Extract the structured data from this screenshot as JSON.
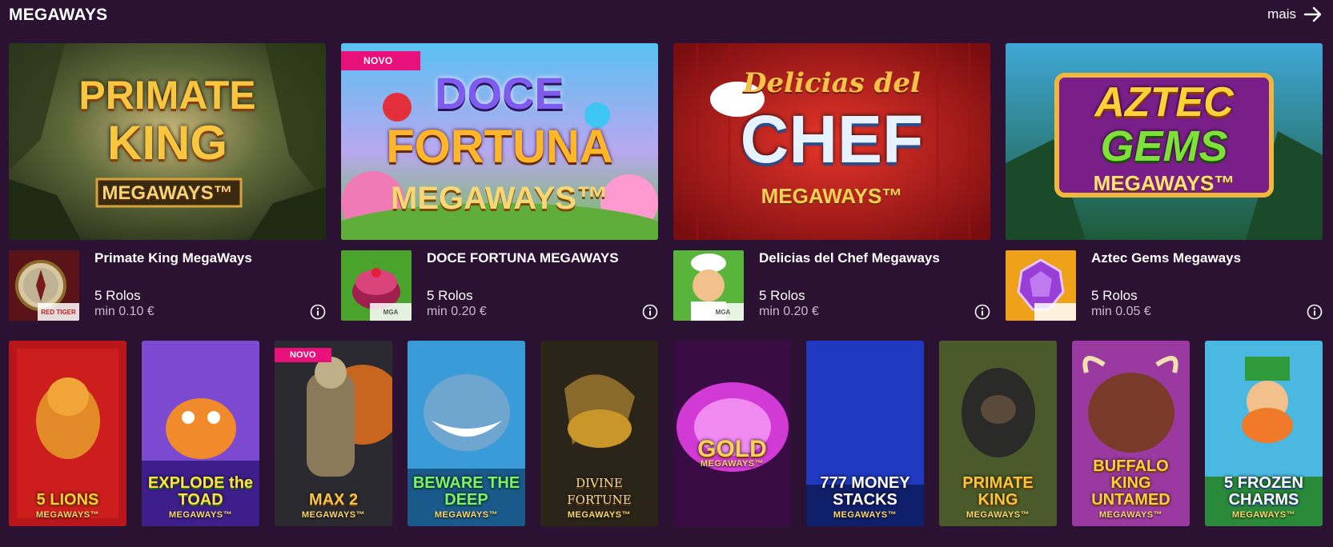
{
  "section": {
    "title": "MEGAWAYS",
    "more_label": "mais"
  },
  "featured": [
    {
      "name": "Primate King MegaWays",
      "reels": "5 Rolos",
      "min": "min 0.10 €",
      "banner_line1": "PRIMATE",
      "banner_line2": "KING",
      "banner_line3": "MEGAWAYS™",
      "provider": "RED TIGER",
      "is_new": false
    },
    {
      "name": "DOCE FORTUNA MEGAWAYS",
      "reels": "5 Rolos",
      "min": "min 0.20 €",
      "banner_line1": "DOCE",
      "banner_line2": "FORTUNA",
      "banner_line3": "MEGAWAYS™",
      "provider": "MGA",
      "is_new": true,
      "badge": "NOVO"
    },
    {
      "name": "Delicias del Chef Megaways",
      "reels": "5 Rolos",
      "min": "min 0.20 €",
      "banner_line1": "Delicias del",
      "banner_line2": "CHEF",
      "banner_line3": "MEGAWAYS™",
      "provider": "MGA",
      "is_new": false
    },
    {
      "name": "Aztec Gems Megaways",
      "reels": "5 Rolos",
      "min": "min 0.05 €",
      "banner_line1": "AZTEC",
      "banner_line2": "GEMS",
      "banner_line3": "MEGAWAYS™",
      "provider": "",
      "is_new": false
    }
  ],
  "tiles": [
    {
      "title": "5 LIONS",
      "sub": "MEGAWAYS™",
      "is_new": false
    },
    {
      "title": "EXPLODE the TOAD",
      "sub": "MEGAWAYS™",
      "is_new": false
    },
    {
      "title": "MAX 2",
      "sub": "MEGAWAYS™",
      "is_new": true,
      "badge": "NOVO"
    },
    {
      "title": "BEWARE THE DEEP",
      "sub": "MEGAWAYS™",
      "is_new": false
    },
    {
      "title": "DIVINE FORTUNE",
      "sub": "MEGAWAYS™",
      "is_new": false
    },
    {
      "title": "GOLD",
      "sub": "MEGAWAYS™",
      "is_new": false
    },
    {
      "title": "777 MONEY STACKS",
      "sub": "MEGAWAYS™",
      "is_new": false
    },
    {
      "title": "PRIMATE KING",
      "sub": "MEGAWAYS™",
      "is_new": false
    },
    {
      "title": "BUFFALO KING UNTAMED",
      "sub": "MEGAWAYS™",
      "is_new": false
    },
    {
      "title": "5 FROZEN CHARMS",
      "sub": "MEGAWAYS™",
      "is_new": false
    }
  ],
  "colors": {
    "background": "#2b1232",
    "badge": "#e8107a",
    "muted_text": "#c9b9cc"
  },
  "icons": {
    "more": "arrow-right-icon",
    "info": "info-icon"
  }
}
